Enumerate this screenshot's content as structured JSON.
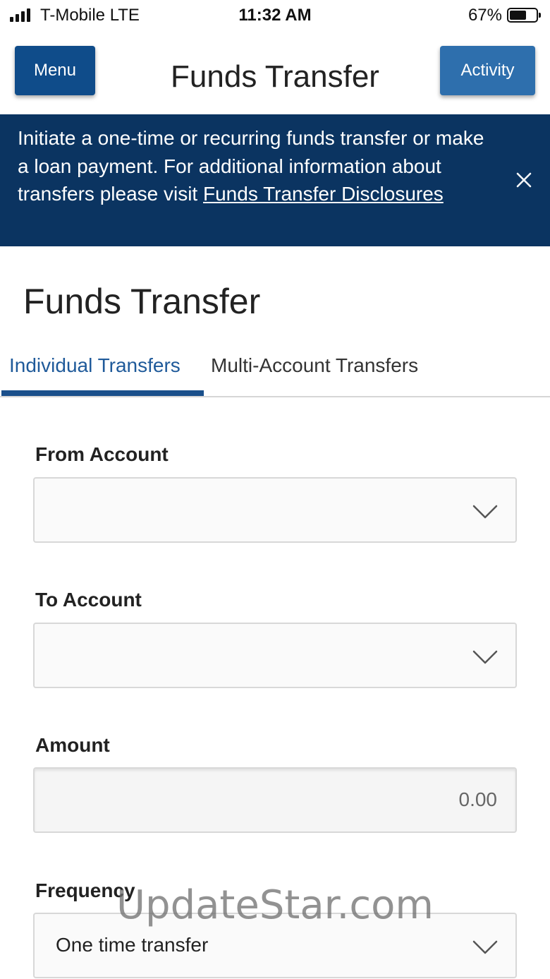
{
  "status_bar": {
    "carrier": "T-Mobile  LTE",
    "time": "11:32 AM",
    "battery_percent": "67%",
    "battery_level": 0.67
  },
  "header": {
    "menu_label": "Menu",
    "title": "Funds Transfer",
    "activity_label": "Activity"
  },
  "banner": {
    "text": "Initiate a one-time or recurring funds transfer or make a loan payment. For additional information about transfers please visit ",
    "link_text": "Funds Transfer Disclosures",
    "close_icon": "close-icon",
    "background": "#0b3461"
  },
  "page": {
    "title": "Funds Transfer"
  },
  "tabs": [
    {
      "label": "Individual Transfers",
      "active": true
    },
    {
      "label": "Multi-Account Transfers",
      "active": false
    }
  ],
  "form": {
    "from_account": {
      "label": "From Account",
      "value": ""
    },
    "to_account": {
      "label": "To Account",
      "value": ""
    },
    "amount": {
      "label": "Amount",
      "placeholder": "0.00"
    },
    "frequency": {
      "label": "Frequency",
      "value": "One time transfer"
    }
  },
  "watermark": "UpdateStar.com",
  "colors": {
    "primary": "#0f4c8a",
    "secondary_button": "#2e6fad",
    "tab_active": "#1f5a9a"
  }
}
